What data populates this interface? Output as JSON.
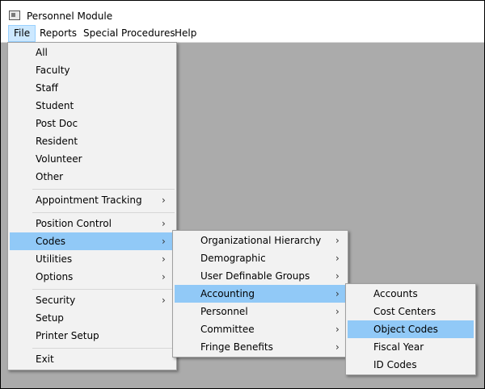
{
  "window": {
    "title": "Personnel Module"
  },
  "menubar": {
    "items": [
      "File",
      "Reports",
      "Special Procedures",
      "Help"
    ]
  },
  "file_menu": {
    "items": [
      "All",
      "Faculty",
      "Staff",
      "Student",
      "Post Doc",
      "Resident",
      "Volunteer",
      "Other",
      "Appointment Tracking",
      "Position Control",
      "Codes",
      "Utilities",
      "Options",
      "Security",
      "Setup",
      "Printer Setup",
      "Exit"
    ],
    "highlighted": "Codes"
  },
  "codes_menu": {
    "items": [
      "Organizational Hierarchy",
      "Demographic",
      "User Definable Groups",
      "Accounting",
      "Personnel",
      "Committee",
      "Fringe Benefits"
    ],
    "highlighted": "Accounting"
  },
  "accounting_menu": {
    "items": [
      "Accounts",
      "Cost Centers",
      "Object Codes",
      "Fiscal Year",
      "ID Codes"
    ],
    "highlighted": "Object Codes"
  },
  "icons": {
    "submenu": "chevron-right-icon",
    "app": "window-icon"
  },
  "colors": {
    "highlight": "#91c9f7",
    "menubar_active": "#cce8ff",
    "client_bg": "#ababab"
  }
}
